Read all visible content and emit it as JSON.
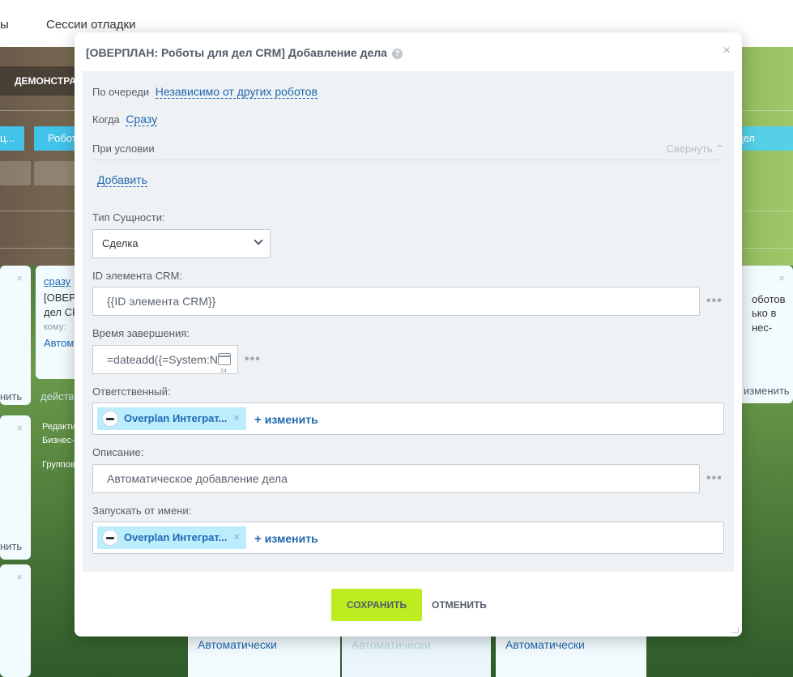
{
  "background": {
    "nav_item_1": "ы",
    "nav_item_2": "Сессии отладки",
    "demo_button": "ДЕМОНСТРА",
    "stage_1": "ц...",
    "stage_2": "Робот",
    "stage_3": "дел",
    "card_left_1": "нить",
    "card_left_2": "нить",
    "card_mid_link": "сразу",
    "card_mid_title_1": "[ОВЕР",
    "card_mid_title_2": "дел CF",
    "card_mid_to": "кому:",
    "card_mid_auto": "Автом",
    "card_mid_action": "действ",
    "card_mid2_line1": "Редакти",
    "card_mid2_line2": "Бизнес-",
    "card_mid2_line3": "Группов",
    "card_right_line1": "оботов",
    "card_right_line2": "ько в",
    "card_right_line3": "нес-",
    "card_right_action": "изменить",
    "bottom_auto_1": "Автоматически",
    "bottom_auto_2": "Автоматически",
    "bottom_auto_3": "Автоматически"
  },
  "modal": {
    "title": "[ОВЕРПЛАН: Роботы для дел CRM] Добавление дела",
    "help_glyph": "?",
    "close_glyph": "×",
    "order_label": "По очереди",
    "order_value": "Независимо от других роботов",
    "when_label": "Когда",
    "when_value": "Сразу",
    "condition_label": "При условии",
    "collapse_label": "Свернуть",
    "add_label": "Добавить",
    "entity_type_label": "Тип Сущности:",
    "entity_type_value": "Сделка",
    "crm_id_label": "ID элемента CRM:",
    "crm_id_value": "{{ID элемента CRM}}",
    "end_time_label": "Время завершения:",
    "end_time_value": "=dateadd({=System:N",
    "calendar_day": "24",
    "responsible_label": "Ответственный:",
    "responsible_name": "Overplan Интеграт...",
    "change_label": "изменить",
    "description_label": "Описание:",
    "description_value": "Автоматическое добавление дела",
    "run_as_label": "Запускать от имени:",
    "run_as_name": "Overplan Интеграт...",
    "chip_remove": "×",
    "more_glyph": "•••",
    "save_label": "СОХРАНИТЬ",
    "cancel_label": "ОТМЕНИТЬ"
  }
}
